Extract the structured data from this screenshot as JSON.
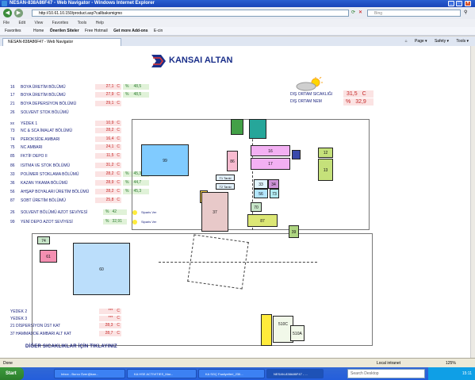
{
  "window": {
    "title": "NESAN-838A86F47 - Web Navigator - Windows Internet Explorer"
  },
  "address": {
    "url": "http://10.61.10.150/product.asp?callbaksmigmo",
    "search_placeholder": "Bing"
  },
  "menu": [
    "File",
    "Edit",
    "View",
    "Favorites",
    "Tools",
    "Help"
  ],
  "favorites": [
    "Favorites",
    "Home",
    "Önerilen Siteler",
    "Free Hotmail",
    "Get more Add-ons",
    "E-cin"
  ],
  "tab": {
    "label": "NESAN-838A86F47 - Web Navigator"
  },
  "tab_tools": [
    "Page ▾",
    "Safety ▾",
    "Tools ▾"
  ],
  "logo": {
    "text": "KANSAI ALTAN"
  },
  "rows": [
    {
      "code": "16",
      "name": "BOYA ÜRETİM BÖLÜMÜ",
      "value": "27,1",
      "unit": "C",
      "rh": "48,5"
    },
    {
      "code": "17",
      "name": "BOYA ÜRETİM BÖLÜMÜ",
      "value": "27,9",
      "unit": "C",
      "rh": "48,5"
    },
    {
      "code": "21",
      "name": "BOYA DEPERSİYON BÖLÜMÜ",
      "value": "29,1",
      "unit": "C",
      "rh": ""
    },
    {
      "code": "26",
      "name": "SOLVENT STOK BÖLÜMÜ",
      "value": "",
      "unit": "",
      "rh": ""
    },
    {
      "code": "xx",
      "name": "YEDEK 1",
      "value": "10,9",
      "unit": "C",
      "rh": ""
    },
    {
      "code": "73",
      "name": "NC & SCA İMALAT BÖLÜMÜ",
      "value": "28,2",
      "unit": "C",
      "rh": ""
    },
    {
      "code": "74",
      "name": "PEROKSİDE AMBARI",
      "value": "16,4",
      "unit": "C",
      "rh": ""
    },
    {
      "code": "75",
      "name": "NC AMBARI",
      "value": "24,1",
      "unit": "C",
      "rh": ""
    },
    {
      "code": "85",
      "name": "FKTİF DEPO II",
      "value": "11,5",
      "unit": "C",
      "rh": ""
    },
    {
      "code": "86",
      "name": "ISITMA VE STOK BÖLÜMÜ",
      "value": "31,2",
      "unit": "C",
      "rh": ""
    },
    {
      "code": "33",
      "name": "POLİMER STOKLAMA BÖLÜMÜ",
      "value": "28,2",
      "unit": "C",
      "rh": "45,3"
    },
    {
      "code": "36",
      "name": "KAZAN YIKAMA BÖLÜMÜ",
      "value": "28,9",
      "unit": "C",
      "rh": "44,7"
    },
    {
      "code": "56",
      "name": "AHŞAP BOYALARI ÜRETİM BÖLÜMÜ",
      "value": "28,2",
      "unit": "C",
      "rh": "45,3"
    },
    {
      "code": "87",
      "name": "SOBT ÜRETİM BÖLÜMÜ",
      "value": "25,8",
      "unit": "C",
      "rh": ""
    }
  ],
  "levels": [
    {
      "code": "26",
      "name": "SOLVENT BÖLÜMÜ AZOT SEVİYESİ",
      "value": "42",
      "alarm": "Siparis Ver"
    },
    {
      "code": "99",
      "name": "YENİ DEPO AZOT SEVİYESİ",
      "value": "32,91",
      "alarm": "Siparis Ver"
    }
  ],
  "spares": [
    {
      "name": "YEDEK 2",
      "value": "***",
      "unit": "C"
    },
    {
      "name": "YEDEK 3",
      "value": "***",
      "unit": "C"
    },
    {
      "name": "21 DİSPERSİYON ÜST KAT",
      "value": "28,3",
      "unit": "C"
    },
    {
      "name": "37 HAMMADDE AMBARI ALT KAT",
      "value": "28,7",
      "unit": "C"
    }
  ],
  "outside": {
    "temp_label": "DIŞ ORTAM SICAKLIĞI",
    "temp_value": "31,5",
    "temp_unit": "C",
    "hum_label": "DIŞ ORTAM NEM",
    "hum_unit": "%",
    "hum_value": "32,9"
  },
  "bottom_link": "DİĞER SICAKLIKLAR İÇİN TIKLAYINIZ",
  "map_labels": {
    "b16": "16",
    "b17": "17",
    "b12": "12",
    "b13": "13",
    "b99": "99",
    "b86": "86",
    "b33": "33",
    "b34": "34",
    "b56": "56",
    "b73": "73",
    "b70": "70",
    "b37": "37",
    "b87": "87",
    "b39": "39",
    "b74": "74",
    "b61": "61",
    "b60": "60",
    "b510c": "510C",
    "b510a": "510A",
    "t1": "T1 Tanki",
    "t2": "T2 Tanki"
  },
  "status": {
    "left": "Done",
    "zone": "Local intranet",
    "zoom": "125%"
  },
  "taskbar": {
    "start": "Start",
    "tasks": [
      "Inbox - Burcu Özer@kan...",
      "KA HSE ACTIVITIES_Mar...",
      "KA SGÇ Faaliyetleri_23II...",
      "NESAN-838A86F47 - ..."
    ],
    "search_placeholder": "Search Desktop",
    "clock": "15:11"
  }
}
